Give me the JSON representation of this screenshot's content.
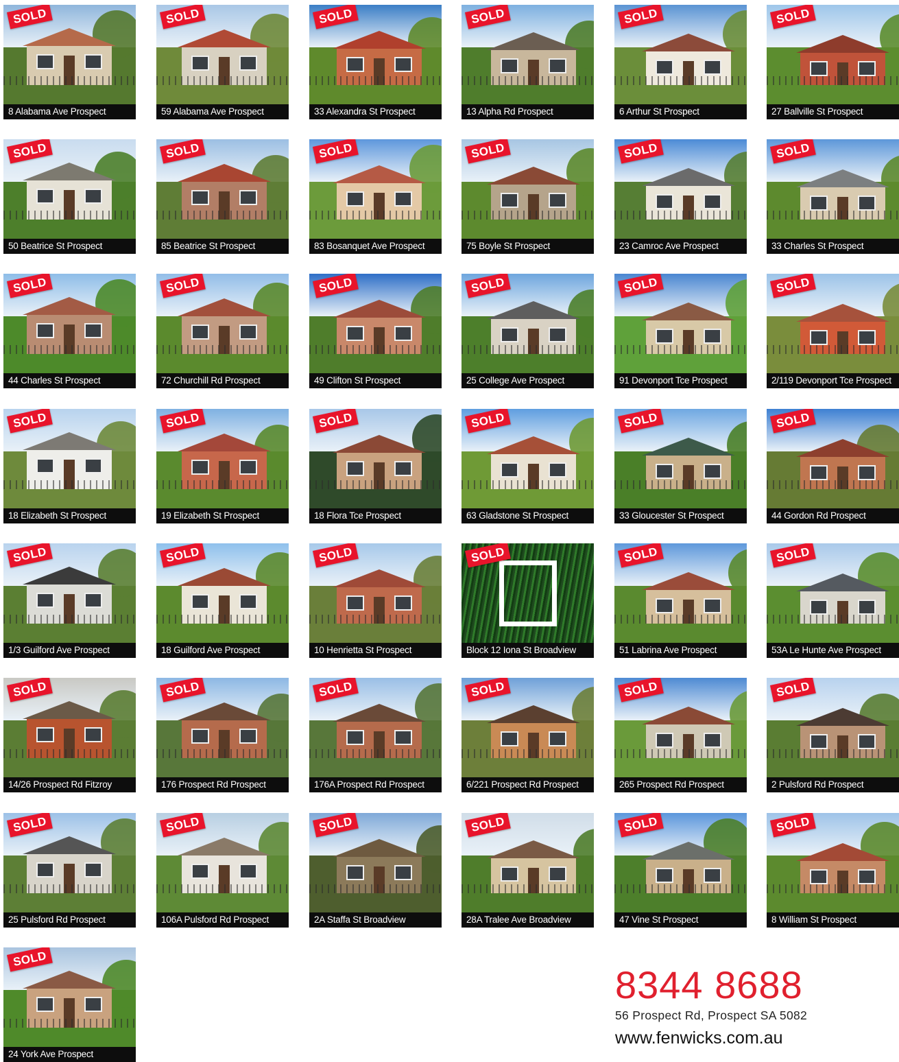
{
  "badge_text": "SOLD",
  "listings": [
    {
      "address": "8 Alabama Ave Prospect",
      "palette": [
        "#b56a4a",
        "#d9cbb0",
        "#55792f",
        "#8fb6dc"
      ]
    },
    {
      "address": "59 Alabama Ave Prospect",
      "palette": [
        "#b04a35",
        "#d8d1c1",
        "#6f8a3a",
        "#a9c7e6"
      ]
    },
    {
      "address": "33 Alexandra St Prospect",
      "palette": [
        "#b0402d",
        "#c66b45",
        "#5f8a2c",
        "#3b7ec6"
      ]
    },
    {
      "address": "13 Alpha Rd Prospect",
      "palette": [
        "#6b5e52",
        "#c8b79c",
        "#4f7d2c",
        "#7db0e0"
      ]
    },
    {
      "address": "6 Arthur St Prospect",
      "palette": [
        "#8c4b3a",
        "#efe9dd",
        "#6b8e3a",
        "#5a93d3"
      ]
    },
    {
      "address": "27 Ballville St Prospect",
      "palette": [
        "#8e3c2c",
        "#c0533a",
        "#5c8d2f",
        "#9ec6ea"
      ]
    },
    {
      "address": "50 Beatrice St Prospect",
      "palette": [
        "#7d7a70",
        "#e6e2d6",
        "#4d7f2b",
        "#c9dcef"
      ]
    },
    {
      "address": "85 Beatrice St Prospect",
      "palette": [
        "#a94632",
        "#b27e66",
        "#5f7d36",
        "#9cbfe3"
      ]
    },
    {
      "address": "83 Bosanquet Ave Prospect",
      "palette": [
        "#b55a45",
        "#e4c9a6",
        "#6c9b3b",
        "#5e97dc"
      ]
    },
    {
      "address": "75 Boyle St Prospect",
      "palette": [
        "#8a4a36",
        "#b5a48b",
        "#5d8a2e",
        "#a7c6e3"
      ]
    },
    {
      "address": "23 Camroc Ave Prospect",
      "palette": [
        "#6b6b6b",
        "#eae5d8",
        "#567e34",
        "#4c8bd6"
      ]
    },
    {
      "address": "33 Charles St Prospect",
      "palette": [
        "#7c7f80",
        "#d9cbb0",
        "#5d8a2e",
        "#5d97d9"
      ]
    },
    {
      "address": "44 Charles St Prospect",
      "palette": [
        "#a35b45",
        "#b98c72",
        "#4d8a2a",
        "#8ebde8"
      ]
    },
    {
      "address": "72 Churchill Rd Prospect",
      "palette": [
        "#a2503c",
        "#c29b82",
        "#5b8a2d",
        "#92bde8"
      ]
    },
    {
      "address": "49 Clifton St Prospect",
      "palette": [
        "#9c4c3a",
        "#c9886a",
        "#4f7d2b",
        "#2f6fc7"
      ]
    },
    {
      "address": "25 College Ave Prospect",
      "palette": [
        "#5e5e5e",
        "#d9d2c4",
        "#4d7f2b",
        "#6ea6de"
      ]
    },
    {
      "address": "91 Devonport Tce Prospect",
      "palette": [
        "#8a5a44",
        "#d8c9a7",
        "#5fa13a",
        "#4a86d1"
      ]
    },
    {
      "address": "2/119 Devonport Tce Prospect",
      "palette": [
        "#a6523c",
        "#d15a38",
        "#7a8d3c",
        "#9cc3e8"
      ]
    },
    {
      "address": "18 Elizabeth St Prospect",
      "palette": [
        "#7d7a74",
        "#eeeeea",
        "#6e8a3c",
        "#b8d3ee"
      ]
    },
    {
      "address": "19 Elizabeth St Prospect",
      "palette": [
        "#a4483a",
        "#c7674b",
        "#5a8a2e",
        "#7fb1e2"
      ]
    },
    {
      "address": "18 Flora Tce Prospect",
      "palette": [
        "#8b4936",
        "#c9a27f",
        "#2f4a2a",
        "#a8c7e8"
      ]
    },
    {
      "address": "63 Gladstone St Prospect",
      "palette": [
        "#a65038",
        "#e9e2d2",
        "#6f9a36",
        "#5f9ee0"
      ]
    },
    {
      "address": "33 Gloucester St Prospect",
      "palette": [
        "#3d5a4a",
        "#c9b08a",
        "#4a7f28",
        "#6fa8e2"
      ]
    },
    {
      "address": "44 Gordon Rd Prospect",
      "palette": [
        "#8d3f2e",
        "#c07650",
        "#667b34",
        "#3e80d2"
      ]
    },
    {
      "address": "1/3 Guilford Ave Prospect",
      "palette": [
        "#3b3b3b",
        "#dcdcd6",
        "#5b7f33",
        "#b9d3ee"
      ]
    },
    {
      "address": "18 Guilford Ave Prospect",
      "palette": [
        "#9a4a35",
        "#eae5d7",
        "#5c8a2e",
        "#8ec0ec"
      ]
    },
    {
      "address": "10 Henrietta St Prospect",
      "palette": [
        "#9f4a38",
        "#bf6a4c",
        "#6a7f3a",
        "#a7c9ea"
      ]
    },
    {
      "address": "Block 12 Iona St Broadview",
      "palette": [
        "#1f4a1f",
        "#2f7a2a",
        "#123c12",
        "#183b18"
      ]
    },
    {
      "address": "51 Labrina Ave Prospect",
      "palette": [
        "#9a4c3a",
        "#d6bf9c",
        "#5a8a2f",
        "#5e98db"
      ]
    },
    {
      "address": "53A Le Hunte Ave Prospect",
      "palette": [
        "#555a60",
        "#d9d6cc",
        "#5b8e30",
        "#a9c9ea"
      ]
    },
    {
      "address": "14/26 Prospect Rd Fitzroy",
      "palette": [
        "#6b5a48",
        "#b8542f",
        "#5b7d34",
        "#c9c9c4"
      ]
    },
    {
      "address": "176 Prospect Rd Prospect",
      "palette": [
        "#6a4a38",
        "#b56b4c",
        "#58773a",
        "#8db8e4"
      ]
    },
    {
      "address": "176A Prospect Rd Prospect",
      "palette": [
        "#6a4a38",
        "#b56b4c",
        "#58773a",
        "#9abfe6"
      ]
    },
    {
      "address": "6/221 Prospect Rd Prospect",
      "palette": [
        "#5b4030",
        "#c98a55",
        "#6d7f3a",
        "#6ea0d8"
      ]
    },
    {
      "address": "265 Prospect Rd Prospect",
      "palette": [
        "#8a4a36",
        "#cfc9b5",
        "#6a9a3a",
        "#4e8ad3"
      ]
    },
    {
      "address": "2 Pulsford Rd Prospect",
      "palette": [
        "#4c3b33",
        "#b99376",
        "#5a7d33",
        "#b8d2ee"
      ]
    },
    {
      "address": "25 Pulsford Rd Prospect",
      "palette": [
        "#555555",
        "#d8d4ca",
        "#5d7f36",
        "#9cc1e7"
      ]
    },
    {
      "address": "106A Pulsford Rd Prospect",
      "palette": [
        "#8a7a68",
        "#e8e4dc",
        "#5e8a36",
        "#b8cfe2"
      ]
    },
    {
      "address": "2A Staffa St Broadview",
      "palette": [
        "#6e5a40",
        "#8c7a5a",
        "#4e5e2e",
        "#7fa9d8"
      ]
    },
    {
      "address": "28A Tralee Ave Broadview",
      "palette": [
        "#7a5a45",
        "#d6c4a0",
        "#4f7d2b",
        "#d0dde8"
      ]
    },
    {
      "address": "47 Vine St Prospect",
      "palette": [
        "#6b6f6a",
        "#c9b08a",
        "#4d7f2b",
        "#5b96dc"
      ]
    },
    {
      "address": "8 William St Prospect",
      "palette": [
        "#a34a36",
        "#c58a66",
        "#5c8a2e",
        "#9ec3e8"
      ]
    },
    {
      "address": "24 York Ave Prospect",
      "palette": [
        "#8a5a45",
        "#c9a27f",
        "#4f8a2a",
        "#a9c4df"
      ]
    }
  ],
  "contact": {
    "phone": "8344 8688",
    "address": "56 Prospect Rd, Prospect SA 5082",
    "website": "www.fenwicks.com.au"
  },
  "colors": {
    "badge": "#e8142b",
    "phone": "#e0202e",
    "caption_bg": "#0d0d0d"
  }
}
